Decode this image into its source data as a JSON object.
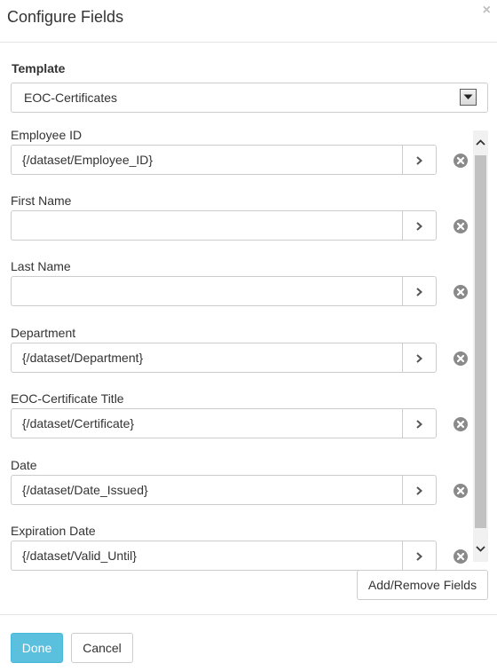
{
  "dialog": {
    "title": "Configure Fields",
    "close_label": "×"
  },
  "template": {
    "label": "Template",
    "selected": "EOC-Certificates"
  },
  "fields": [
    {
      "label": "Employee ID",
      "value": "{/dataset/Employee_ID}"
    },
    {
      "label": "First Name",
      "value": ""
    },
    {
      "label": "Last Name",
      "value": ""
    },
    {
      "label": "Department",
      "value": "{/dataset/Department}"
    },
    {
      "label": "EOC-Certificate Title",
      "value": "{/dataset/Certificate}"
    },
    {
      "label": "Date",
      "value": "{/dataset/Date_Issued}"
    },
    {
      "label": "Expiration Date",
      "value": "{/dataset/Valid_Until}"
    }
  ],
  "buttons": {
    "add_remove": "Add/Remove Fields",
    "done": "Done",
    "cancel": "Cancel"
  },
  "icons": {
    "field_button": "chevron-right-icon",
    "remove": "remove-circle-icon",
    "select_arrow": "chevron-down-icon"
  },
  "colors": {
    "done_bg": "#5bc0de",
    "remove_icon": "#8a8a8a"
  }
}
